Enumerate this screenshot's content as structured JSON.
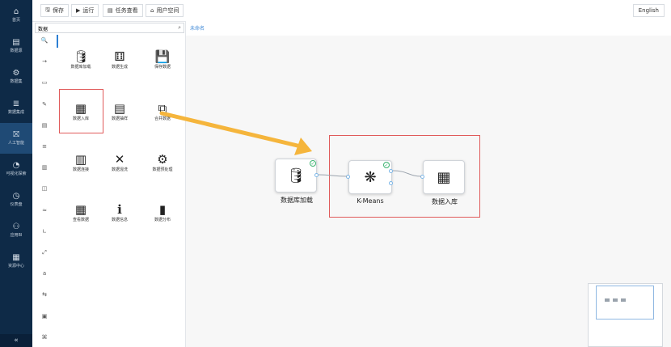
{
  "nav": {
    "items": [
      {
        "icon": "⌂",
        "label": "首页"
      },
      {
        "icon": "▤",
        "label": "数据源"
      },
      {
        "icon": "⚙",
        "label": "数据集"
      },
      {
        "icon": "≣",
        "label": "数据集成"
      },
      {
        "icon": "⛝",
        "label": "人工智能",
        "active": true
      },
      {
        "icon": "◔",
        "label": "可视化探索"
      },
      {
        "icon": "◷",
        "label": "仪表盘"
      },
      {
        "icon": "⚇",
        "label": "应用BI"
      },
      {
        "icon": "▦",
        "label": "资源中心"
      }
    ],
    "collapse_icon": "«"
  },
  "toolbar": {
    "save": "保存",
    "run": "运行",
    "tasks": "任务查看",
    "user_space": "用户空间",
    "language": "English"
  },
  "palette": {
    "search_value": "数据",
    "category_icons": [
      "🔍",
      "→",
      "▭",
      "✎",
      "▤",
      "≡",
      "▥",
      "◫",
      "≈",
      "∟",
      "⤢",
      "a",
      "⇆",
      "▣",
      "⌘"
    ],
    "tiles": [
      {
        "icon": "🛢",
        "label": "数据库加载"
      },
      {
        "icon": "⚅",
        "label": "数据生成"
      },
      {
        "icon": "💾",
        "label": "保存数据"
      },
      {
        "icon": "▦",
        "label": "数据入库"
      },
      {
        "icon": "▤",
        "label": "数据抽样"
      },
      {
        "icon": "⧉",
        "label": "合并数据"
      },
      {
        "icon": "▥",
        "label": "数据连接"
      },
      {
        "icon": "✕",
        "label": "数据混洗"
      },
      {
        "icon": "⚙",
        "label": "数据预处理"
      },
      {
        "icon": "▦",
        "label": "查看数据"
      },
      {
        "icon": "ℹ",
        "label": "数据信息"
      },
      {
        "icon": "▮",
        "label": "数据分布"
      }
    ]
  },
  "canvas": {
    "tab": "未命名",
    "nodes": [
      {
        "label": "数据库加载",
        "icon": "🛢"
      },
      {
        "label": "K-Means",
        "icon": "❋"
      },
      {
        "label": "数据入库",
        "icon": "▦"
      }
    ],
    "check_glyph": "✓"
  },
  "colors": {
    "nav_bg": "#0e2a47",
    "highlight": "#e05b5b",
    "arrow": "#f5b53c",
    "accent": "#2d7fd3"
  }
}
